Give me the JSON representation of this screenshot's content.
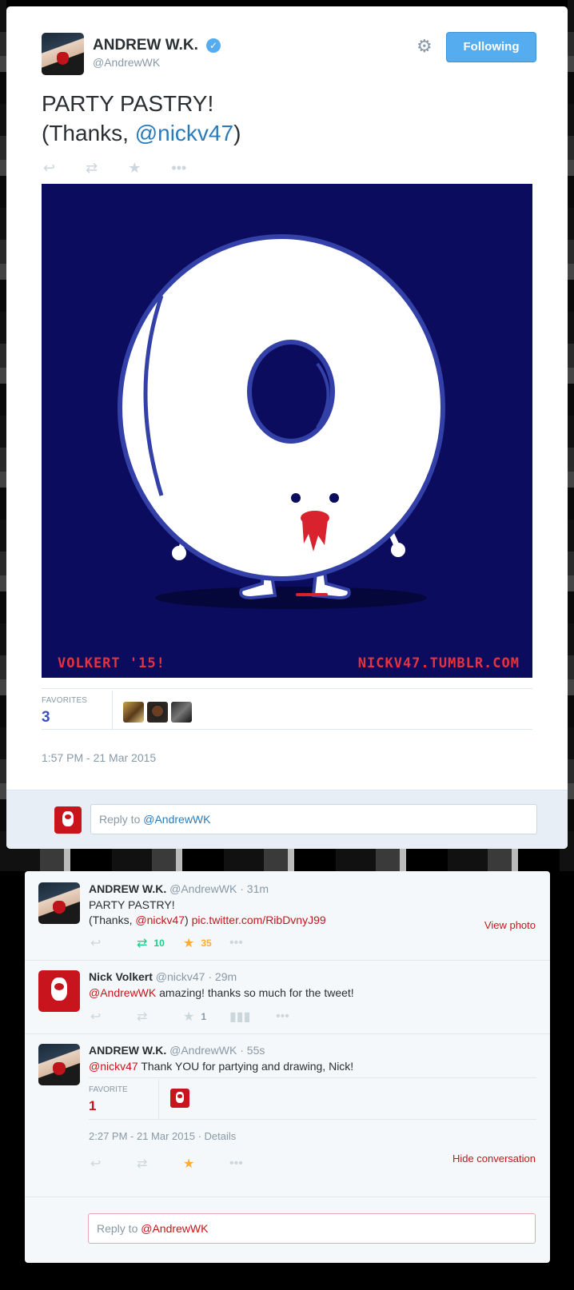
{
  "main_tweet": {
    "author_name": "ANDREW W.K.",
    "handle": "@AndrewWK",
    "follow_label": "Following",
    "text_line1": "PARTY PASTRY!",
    "text_thanks": "(Thanks, ",
    "text_mention": "@nickv47",
    "text_close": ")",
    "image_caption_left": "VOLKERT '15!",
    "image_caption_right": "NICKV47.TUMBLR.COM",
    "favorites_label": "FAVORITES",
    "favorites_count": "3",
    "timestamp": "1:57 PM - 21 Mar 2015",
    "reply_prefix": "Reply to ",
    "reply_handle": "@AndrewWK"
  },
  "conversation": {
    "tweet1": {
      "name": "ANDREW W.K.",
      "meta": "@AndrewWK · 31m",
      "line1": "PARTY PASTRY!",
      "line2_prefix": "(Thanks, ",
      "line2_mention": "@nickv47",
      "line2_suffix": ") ",
      "pic_link": "pic.twitter.com/RibDvnyJ99",
      "view_photo": "View photo",
      "retweets": "10",
      "favorites": "35"
    },
    "tweet2": {
      "name": "Nick Volkert",
      "meta": "@nickv47 · 29m",
      "mention": "@AndrewWK",
      "text": " amazing!  thanks so much for the tweet!",
      "favorites": "1"
    },
    "tweet3": {
      "name": "ANDREW W.K.",
      "meta": "@AndrewWK · 55s",
      "mention": "@nickv47",
      "text": " Thank YOU for partying and drawing, Nick!",
      "favorite_label": "FAVORITE",
      "favorite_count": "1",
      "timestamp": "2:27 PM - 21 Mar 2015 · Details",
      "hide_conversation": "Hide conversation"
    },
    "reply_prefix": "Reply to ",
    "reply_handle": "@AndrewWK"
  },
  "icons": {
    "reply": "reply-icon",
    "retweet": "retweet-icon",
    "favorite": "star-icon",
    "more": "more-icon",
    "stats": "stats-icon",
    "settings": "gear-icon",
    "verified": "verified-icon"
  },
  "colors": {
    "twitter_blue": "#55acee",
    "link_blue": "#2b7bb9",
    "accent_red": "#c8141c",
    "retweet_green": "#19cf86",
    "favorite_gold": "#ffac33",
    "art_background": "#0b0c5e"
  }
}
